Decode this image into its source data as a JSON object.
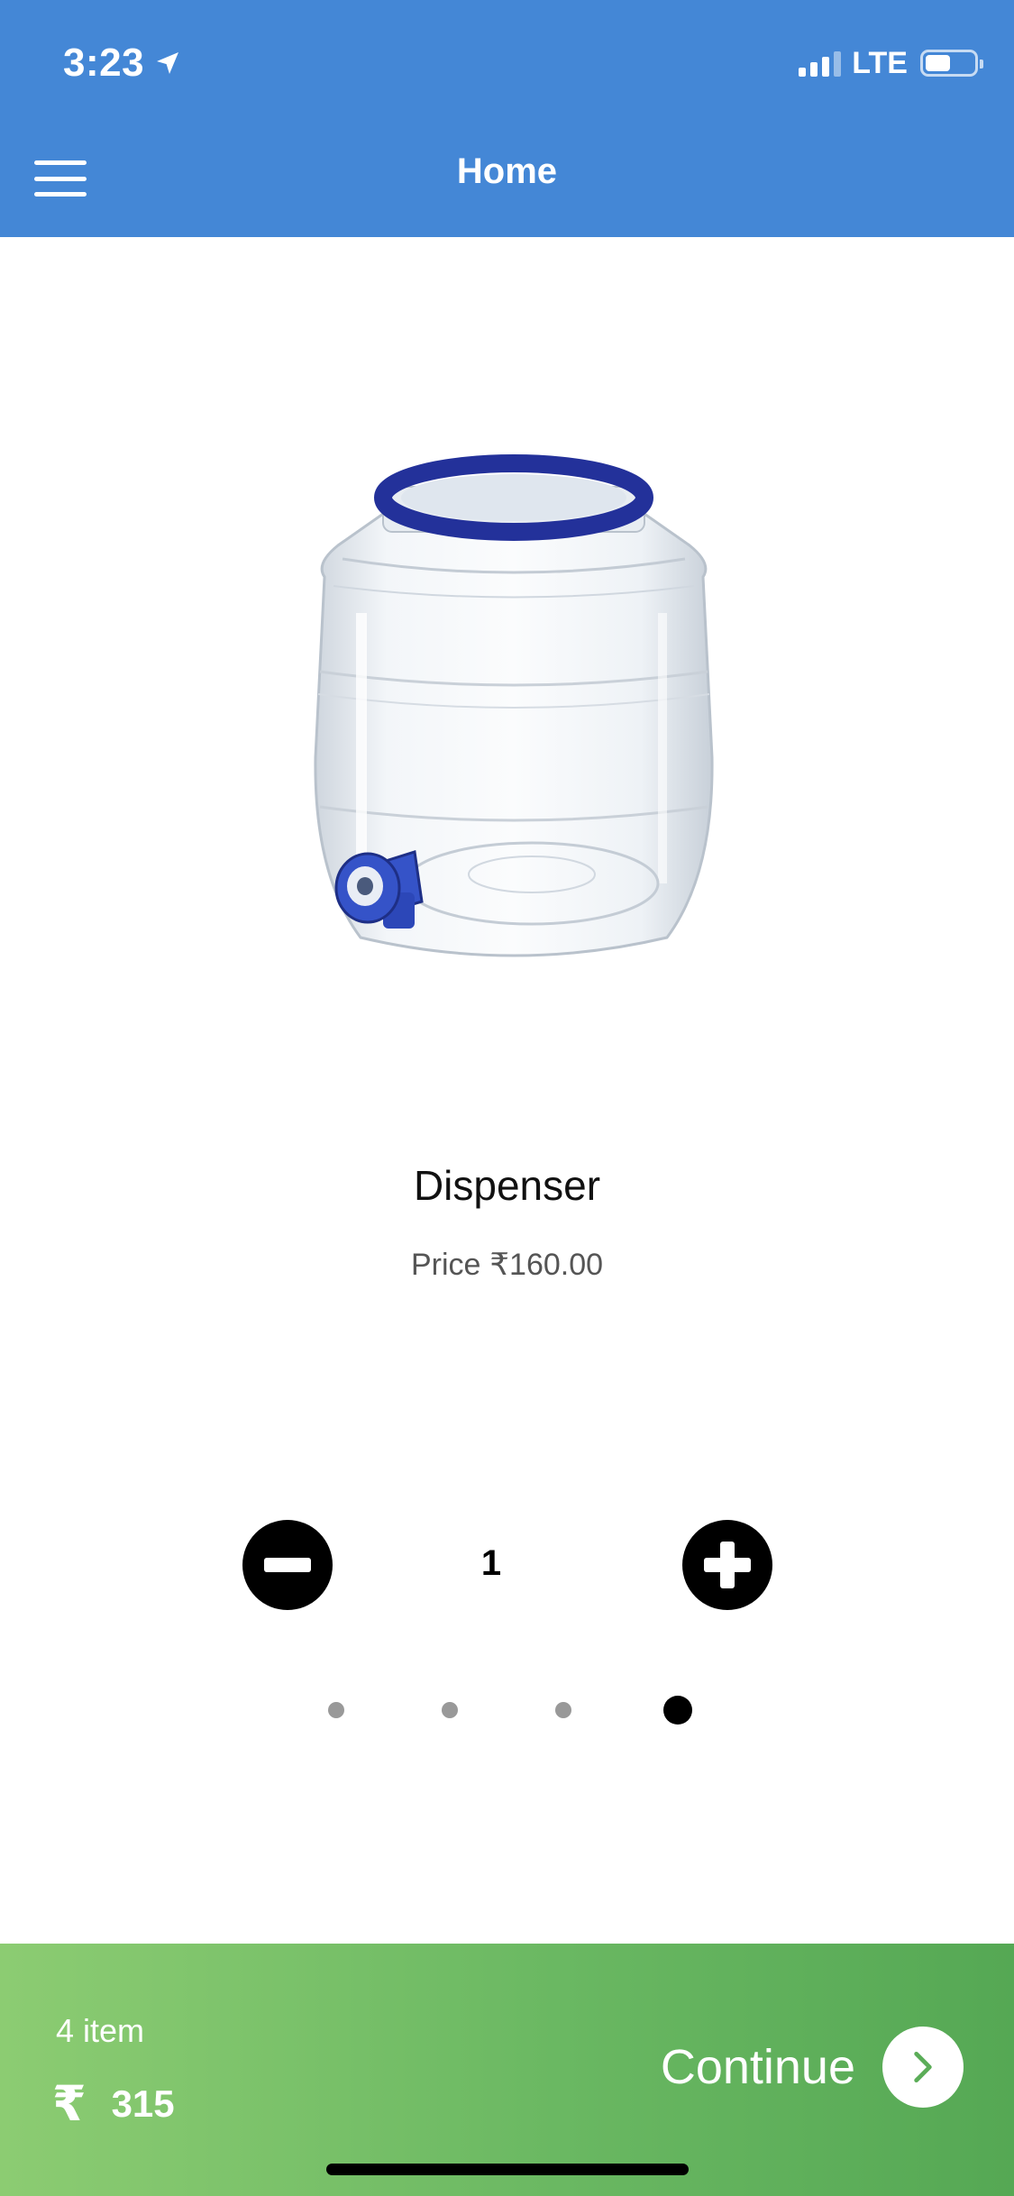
{
  "status_bar": {
    "time": "3:23",
    "network": "LTE",
    "battery_level": 0.45,
    "signal_bars": 3,
    "signal_total": 4
  },
  "header": {
    "title": "Home",
    "menu_icon": "hamburger-menu-icon",
    "background_color": "#4487d6"
  },
  "product": {
    "name": "Dispenser",
    "price_label": "Price",
    "price_value": "₹160.00",
    "image_icon": "water-dispenser-jar"
  },
  "quantity": {
    "value": "1",
    "decrement_icon": "minus-circle-icon",
    "increment_icon": "plus-circle-icon"
  },
  "pagination": {
    "total": 4,
    "active_index": 3
  },
  "cart": {
    "item_count": "4 item",
    "currency_symbol": "₹",
    "total": "315",
    "continue_label": "Continue",
    "continue_icon": "chevron-right-icon",
    "gradient_start": "#8ccc72",
    "gradient_end": "#55a854"
  }
}
